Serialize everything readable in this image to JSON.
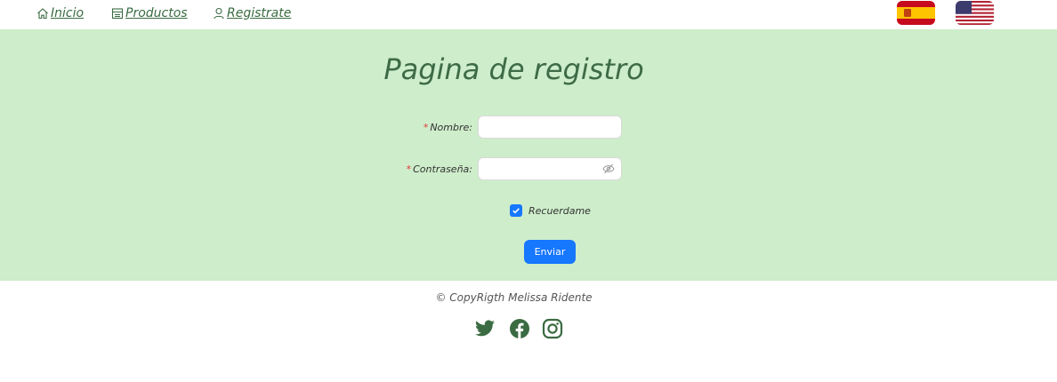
{
  "nav": {
    "inicio": "Inicio",
    "productos": "Productos",
    "registrate": "Registrate"
  },
  "flags": [
    "spain-flag-icon",
    "usa-flag-icon"
  ],
  "form": {
    "title": "Pagina de registro",
    "required_mark": "*",
    "nombre_label": "Nombre",
    "contrasena_label": "Contraseña",
    "label_colon": ":",
    "nombre_value": "",
    "contrasena_value": "",
    "remember_label": "Recuerdame",
    "remember_checked": true,
    "submit_label": "Enviar"
  },
  "footer": {
    "copyright": "© CopyRigth Melissa Ridente",
    "social": [
      "twitter-icon",
      "facebook-icon",
      "instagram-icon"
    ]
  },
  "colors": {
    "band": "#ceedca",
    "title": "#3d6b45",
    "accent": "#1677ff",
    "social": "#3a6b42"
  }
}
